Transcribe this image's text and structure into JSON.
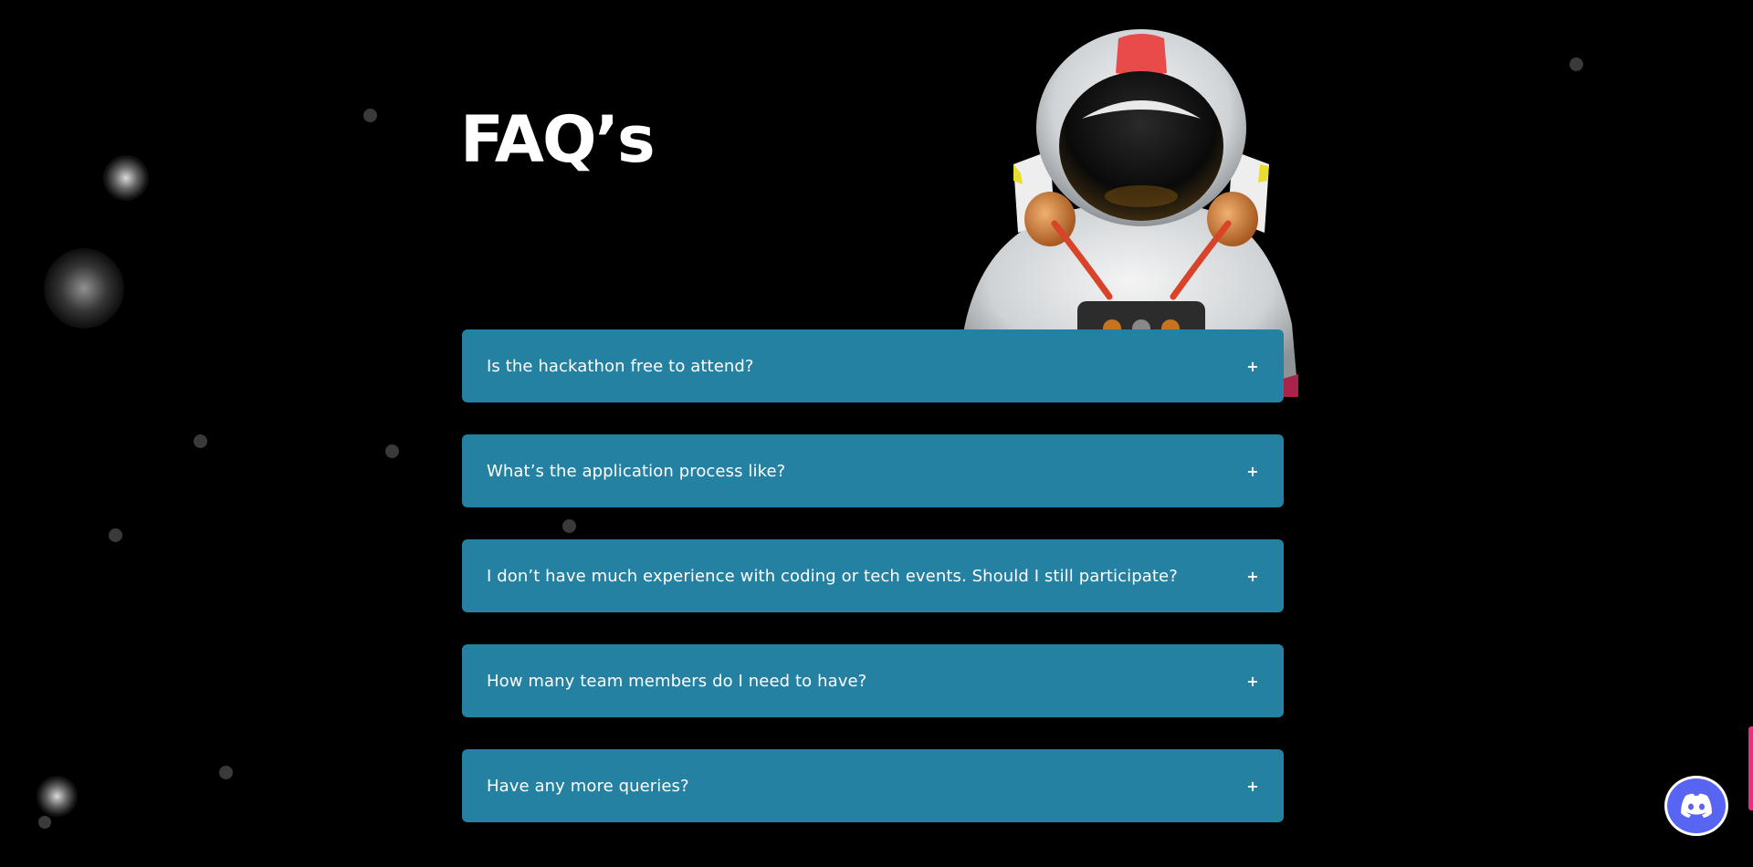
{
  "section": {
    "title": "FAQ’s"
  },
  "faq": {
    "expand_symbol": "+",
    "items": [
      {
        "question": "Is the hackathon free to attend?"
      },
      {
        "question": "What’s the application process like?"
      },
      {
        "question": "I don’t have much experience with coding or tech events. Should I still participate?"
      },
      {
        "question": "How many team members do I need to have?"
      },
      {
        "question": "Have any more queries?"
      }
    ]
  },
  "icons": {
    "hero": "astronaut-illustration",
    "chat": "discord-icon"
  },
  "colors": {
    "background": "#000000",
    "faq_item": "#2481a1",
    "text": "#ffffff",
    "scroll_accent": "#e8307e",
    "discord": "#5865f2"
  }
}
